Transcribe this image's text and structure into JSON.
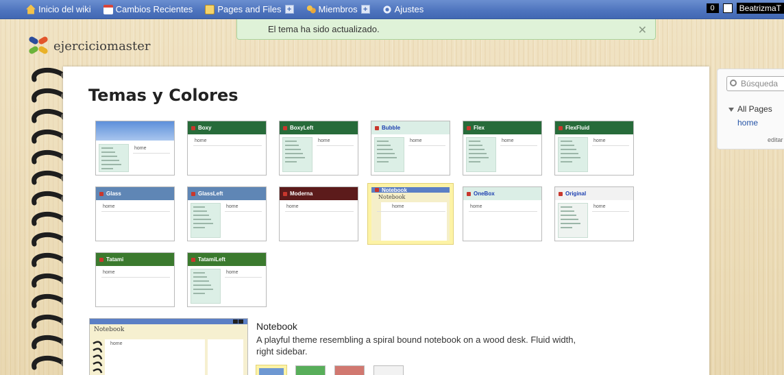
{
  "nav": {
    "home": "Inicio del wiki",
    "recent": "Cambios Recientes",
    "pages": "Pages and Files",
    "members": "Miembros",
    "settings": "Ajustes",
    "plus": "+"
  },
  "user": {
    "count": "0",
    "name": "BeatrizmaT"
  },
  "notice": {
    "text": "El tema ha sido actualizado.",
    "close": "✕"
  },
  "site": {
    "name": "ejerciciomaster"
  },
  "page": {
    "title": "Temas y Colores"
  },
  "themes": [
    {
      "name": "",
      "home": "home",
      "color": "#6c9be0"
    },
    {
      "name": "Boxy",
      "home": "home",
      "color": "#276b3a"
    },
    {
      "name": "BoxyLeft",
      "home": "home",
      "color": "#276b3a"
    },
    {
      "name": "Bubble",
      "home": "home",
      "color": "#dbeee6"
    },
    {
      "name": "Flex",
      "home": "home",
      "color": "#276b3a"
    },
    {
      "name": "FlexFluid",
      "home": "home",
      "color": "#276b3a"
    },
    {
      "name": "Glass",
      "home": "home",
      "color": "#5f86b5"
    },
    {
      "name": "GlassLeft",
      "home": "home",
      "color": "#5f86b5"
    },
    {
      "name": "Moderna",
      "home": "home",
      "color": "#5c1b1b"
    },
    {
      "name": "Notebook",
      "home": "home",
      "color": "#5b7fc5"
    },
    {
      "name": "OneBox",
      "home": "home",
      "color": "#dbeee6"
    },
    {
      "name": "Original",
      "home": "home",
      "color": "#f2f2f2"
    },
    {
      "name": "Tatami",
      "home": "home",
      "color": "#3b7a2e"
    },
    {
      "name": "TatamiLeft",
      "home": "home",
      "color": "#3b7a2e"
    }
  ],
  "detail": {
    "preview_name": "Notebook",
    "preview_home": "home",
    "name": "Notebook",
    "description": "A playful theme resembling a spiral bound notebook on a wood desk. Fluid width, right sidebar."
  },
  "swatches": [
    "#6e98d2",
    "#58ae5a",
    "#d17870",
    "#f2f2f2"
  ],
  "sidebar": {
    "search_placeholder": "Búsqueda",
    "all_pages": "All Pages",
    "home_link": "home",
    "edit": "editar"
  }
}
